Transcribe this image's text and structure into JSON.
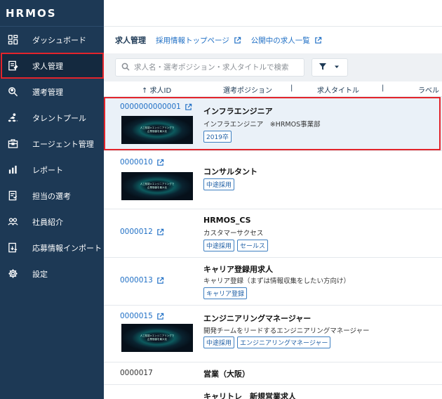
{
  "app": {
    "logo": "HRMOS"
  },
  "sidebar": {
    "items": [
      {
        "label": "ダッシュボード",
        "icon": "dashboard-icon"
      },
      {
        "label": "求人管理",
        "icon": "job-icon",
        "active": true
      },
      {
        "label": "選考管理",
        "icon": "search-person-icon"
      },
      {
        "label": "タレントプール",
        "icon": "pool-icon"
      },
      {
        "label": "エージェント管理",
        "icon": "briefcase-icon"
      },
      {
        "label": "レポート",
        "icon": "bar-chart-icon"
      },
      {
        "label": "担当の選考",
        "icon": "assigned-icon"
      },
      {
        "label": "社員紹介",
        "icon": "people-icon"
      },
      {
        "label": "応募情報インポート",
        "icon": "import-icon"
      },
      {
        "label": "設定",
        "icon": "gear-icon"
      }
    ]
  },
  "breadcrumb": {
    "current": "求人管理",
    "link1": "採用情報トップページ",
    "link2": "公開中の求人一覧"
  },
  "search": {
    "placeholder": "求人名・選考ポジション・求人タイトルで検索",
    "value": ""
  },
  "table": {
    "columns": {
      "id": "↑ 求人ID",
      "position": "選考ポジション",
      "title": "求人タイトル",
      "label": "ラベル"
    },
    "sep": "|",
    "rows": [
      {
        "id": "0000000000001",
        "title": "インフラエンジニア",
        "subtitle": "インフラエンジニア　※HRMOS事業部",
        "tags": [
          "2019卒"
        ],
        "thumb_text": "人工知能×エンジニアリングで\n企業価値を最大化"
      },
      {
        "id": "0000010",
        "title": "コンサルタント",
        "subtitle": "",
        "tags": [
          "中途採用"
        ],
        "thumb_text": "人工知能×エンジニアリングで\n企業価値を最大化"
      },
      {
        "id": "0000012",
        "title": "HRMOS_CS",
        "subtitle": "カスタマーサクセス",
        "tags": [
          "中途採用",
          "セールス"
        ]
      },
      {
        "id": "0000013",
        "title": "キャリア登録用求人",
        "subtitle": "キャリア登録（まずは情報収集をしたい方向け）",
        "tags": [
          "キャリア登録"
        ]
      },
      {
        "id": "0000015",
        "title": "エンジニアリングマネージャー",
        "subtitle": "開発チームをリードするエンジニアリングマネージャー",
        "tags": [
          "中途採用",
          "エンジニアリングマネージャー"
        ],
        "thumb_text": "人工知能×エンジニアリングで\n企業価値を最大化"
      },
      {
        "id": "0000017",
        "title": "営業（大阪）",
        "subtitle": "",
        "tags": []
      },
      {
        "id": "",
        "title": "キャリトレ　新規営業求人",
        "subtitle": "",
        "tags": []
      }
    ]
  },
  "colors": {
    "sidebar": "#1d3955",
    "accent": "#1f6fc5",
    "highlight": "#e3242b"
  }
}
